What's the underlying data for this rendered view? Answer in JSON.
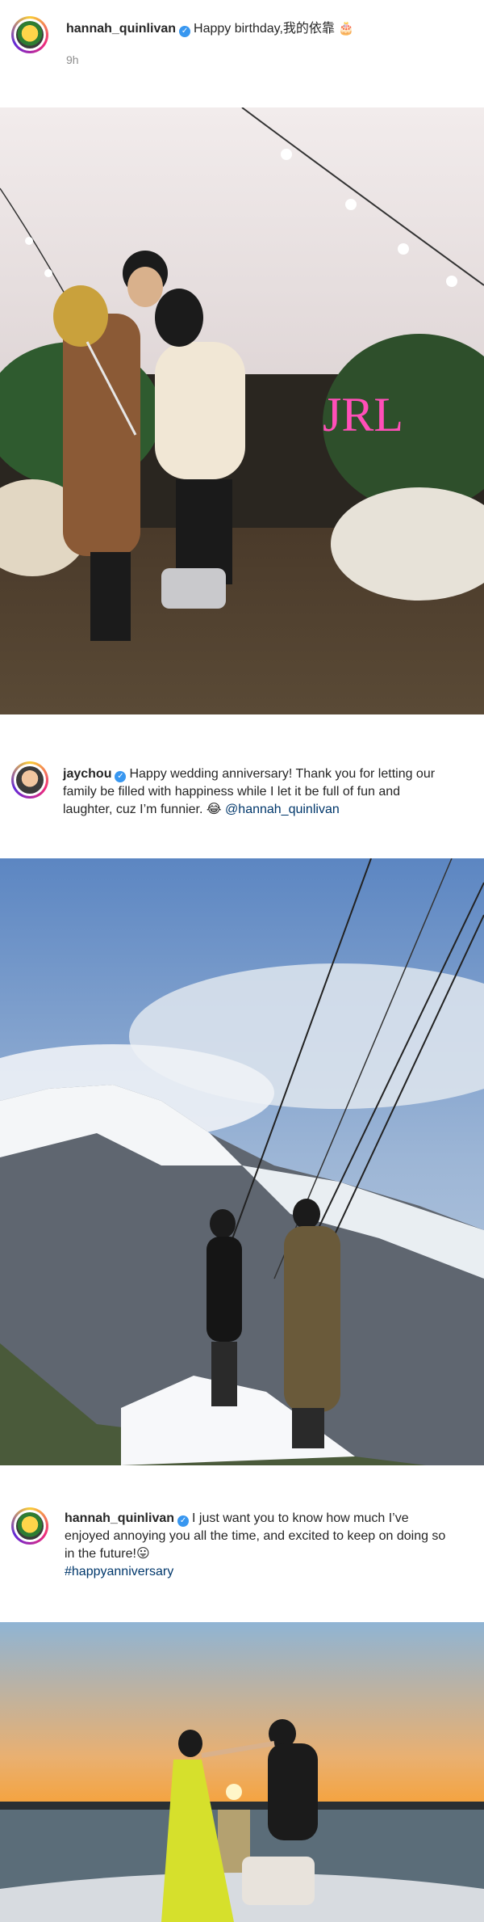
{
  "posts": [
    {
      "username": "hannah_quinlivan",
      "caption": "Happy birthday,我的依靠",
      "emoji": "🎂",
      "time": "9h",
      "photo_label": "JRL"
    },
    {
      "username": "jaychou",
      "caption_line1": "Happy wedding anniversary! Thank you for letting our",
      "caption_line2": "family be filled with happiness while I let it be full of fun and",
      "caption_line3": "laughter, cuz I’m funnier.",
      "emoji": "😂",
      "mention": "@hannah_quinlivan"
    },
    {
      "username": "hannah_quinlivan",
      "caption_line1": "I just want you to know how much I’ve",
      "caption_line2": "enjoyed annoying you all the time, and excited to keep on doing so",
      "caption_line3": "in the future!",
      "emoji": "😛",
      "hashtag": "#happyanniversary"
    }
  ],
  "icons": {
    "verified": "verified-badge-icon"
  },
  "colors": {
    "verified": "#3897f0",
    "link": "#00376b",
    "meta": "#8e8e8e"
  }
}
